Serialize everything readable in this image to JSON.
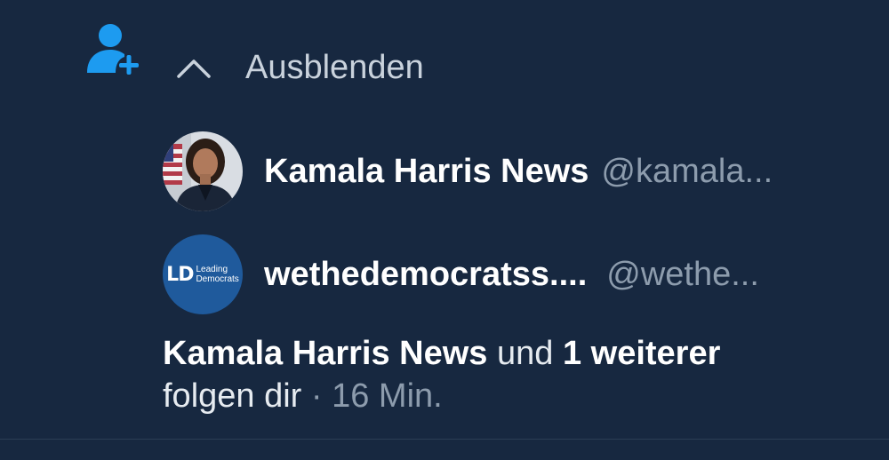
{
  "colors": {
    "background": "#172840",
    "accent": "#1d9bf0",
    "secondary_text": "#8d9cad"
  },
  "notification": {
    "icon": "person-plus-icon",
    "collapse": {
      "icon": "chevron-up-icon",
      "label": "Ausblenden"
    },
    "accounts": [
      {
        "name": "Kamala Harris News",
        "handle": "@kamala...",
        "avatar": "portrait-photo"
      },
      {
        "name": "wethedemocratss....",
        "handle": "@wethe...",
        "avatar": "leading-democrats-logo",
        "logo_mark": "LD",
        "logo_line1": "Leading",
        "logo_line2": "Democrats"
      }
    ],
    "summary": {
      "actor": "Kamala Harris News",
      "connector": "und",
      "others": "1 weiterer",
      "action": "folgen dir",
      "separator": "·",
      "time": "16 Min."
    }
  }
}
